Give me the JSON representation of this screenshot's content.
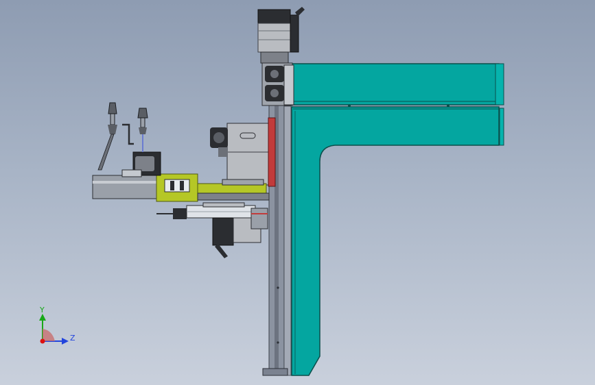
{
  "triad": {
    "y_label": "Y",
    "z_label": "Z",
    "colors": {
      "y_axis": "#18a818",
      "z_axis": "#2244dd",
      "x_axis": "#dd1111"
    }
  },
  "colors": {
    "frame_teal": "#04a6a0",
    "frame_edge": "#0b4f4b",
    "rail": "#8b93a1",
    "bracket_yellow": "#b5c726",
    "motor_dark": "#2b2d31",
    "motor_gray": "#b9bcc1",
    "accent_red": "#c23b3b"
  }
}
